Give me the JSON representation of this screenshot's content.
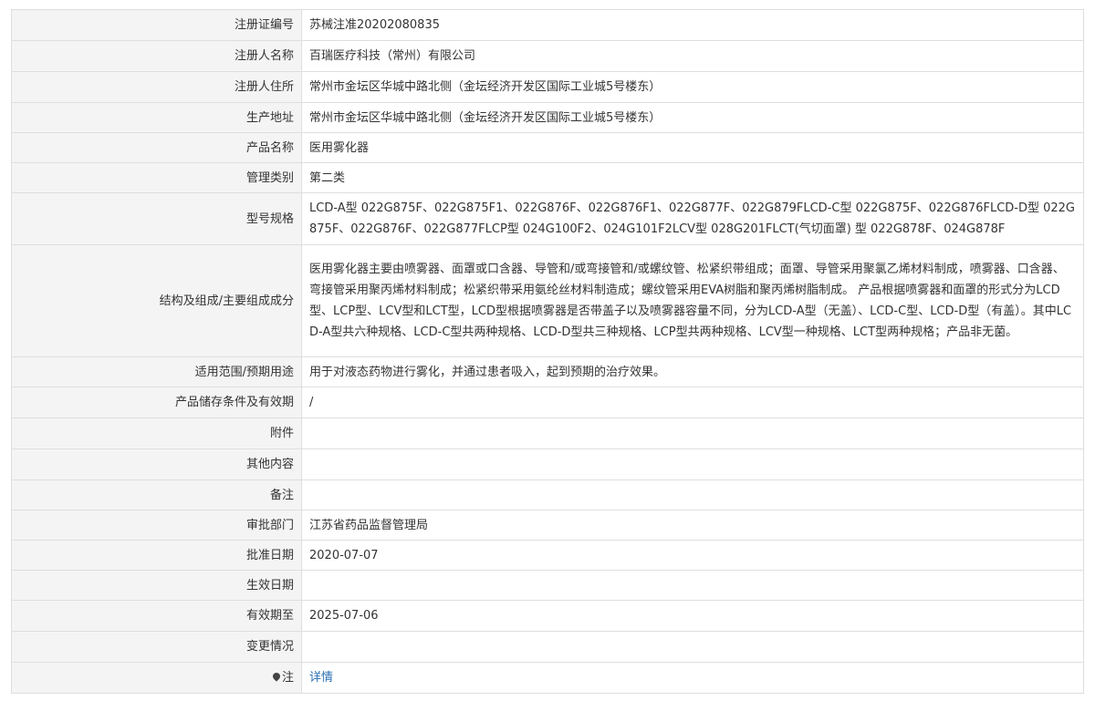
{
  "rows": [
    {
      "label": "注册证编号",
      "value": "苏械注准20202080835"
    },
    {
      "label": "注册人名称",
      "value": "百瑞医疗科技（常州）有限公司"
    },
    {
      "label": "注册人住所",
      "value": "常州市金坛区华城中路北侧（金坛经济开发区国际工业城5号楼东）"
    },
    {
      "label": "生产地址",
      "value": "常州市金坛区华城中路北侧（金坛经济开发区国际工业城5号楼东）"
    },
    {
      "label": "产品名称",
      "value": "医用雾化器"
    },
    {
      "label": "管理类别",
      "value": "第二类"
    },
    {
      "label": "型号规格",
      "value": "LCD-A型 022G875F、022G875F1、022G876F、022G876F1、022G877F、022G879FLCD-C型 022G875F、022G876FLCD-D型 022G875F、022G876F、022G877FLCP型 024G100F2、024G101F2LCV型 028G201FLCT(气切面罩) 型 022G878F、024G878F"
    },
    {
      "label": "结构及组成/主要组成成分",
      "value": "医用雾化器主要由喷雾器、面罩或口含器、导管和/或弯接管和/或螺纹管、松紧织带组成；面罩、导管采用聚氯乙烯材料制成，喷雾器、口含器、弯接管采用聚丙烯材料制成；松紧织带采用氨纶丝材料制造成；螺纹管采用EVA树脂和聚丙烯树脂制成。 产品根据喷雾器和面罩的形式分为LCD型、LCP型、LCV型和LCT型，LCD型根据喷雾器是否带盖子以及喷雾器容量不同，分为LCD-A型（无盖）、LCD-C型、LCD-D型（有盖）。其中LCD-A型共六种规格、LCD-C型共两种规格、LCD-D型共三种规格、LCP型共两种规格、LCV型一种规格、LCT型两种规格；产品非无菌。"
    },
    {
      "label": "适用范围/预期用途",
      "value": "用于对液态药物进行雾化，并通过患者吸入，起到预期的治疗效果。"
    },
    {
      "label": "产品储存条件及有效期",
      "value": "/"
    },
    {
      "label": "附件",
      "value": ""
    },
    {
      "label": "其他内容",
      "value": ""
    },
    {
      "label": "备注",
      "value": ""
    },
    {
      "label": "审批部门",
      "value": "江苏省药品监督管理局"
    },
    {
      "label": "批准日期",
      "value": "2020-07-07"
    },
    {
      "label": "生效日期",
      "value": ""
    },
    {
      "label": "有效期至",
      "value": "2025-07-06"
    },
    {
      "label": "变更情况",
      "value": ""
    }
  ],
  "note_row": {
    "label": "注",
    "icon": "pin-icon",
    "link_text": "详情",
    "link_color": "#2a6fb5"
  }
}
